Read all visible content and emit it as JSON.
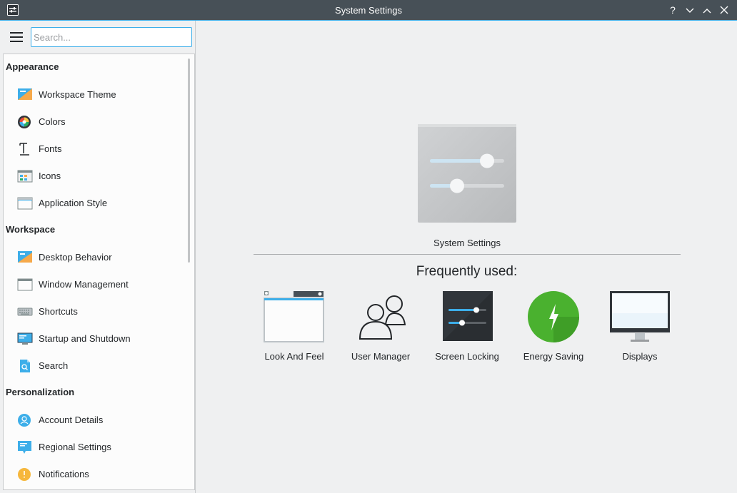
{
  "window": {
    "title": "System Settings",
    "help_glyph": "?",
    "minimize_glyph": "⌄",
    "maximize_glyph": "⌃",
    "close_glyph": "✕"
  },
  "search": {
    "placeholder": "Search..."
  },
  "sidebar": {
    "sections": [
      {
        "title": "Appearance",
        "items": [
          {
            "label": "Workspace Theme",
            "icon": "workspace-theme-icon"
          },
          {
            "label": "Colors",
            "icon": "colors-icon"
          },
          {
            "label": "Fonts",
            "icon": "fonts-icon"
          },
          {
            "label": "Icons",
            "icon": "icons-icon"
          },
          {
            "label": "Application Style",
            "icon": "application-style-icon"
          }
        ]
      },
      {
        "title": "Workspace",
        "items": [
          {
            "label": "Desktop Behavior",
            "icon": "desktop-behavior-icon"
          },
          {
            "label": "Window Management",
            "icon": "window-management-icon"
          },
          {
            "label": "Shortcuts",
            "icon": "keyboard-icon"
          },
          {
            "label": "Startup and Shutdown",
            "icon": "startup-shutdown-icon"
          },
          {
            "label": "Search",
            "icon": "search-icon"
          }
        ]
      },
      {
        "title": "Personalization",
        "items": [
          {
            "label": "Account Details",
            "icon": "account-icon"
          },
          {
            "label": "Regional Settings",
            "icon": "regional-settings-icon"
          },
          {
            "label": "Notifications",
            "icon": "notifications-icon"
          }
        ]
      }
    ]
  },
  "main": {
    "hero_label": "System Settings",
    "frequently_used_title": "Frequently used:",
    "frequent": [
      {
        "label": "Look And Feel",
        "icon": "look-and-feel-icon"
      },
      {
        "label": "User Manager",
        "icon": "users-icon"
      },
      {
        "label": "Screen Locking",
        "icon": "screen-locking-icon"
      },
      {
        "label": "Energy Saving",
        "icon": "energy-saving-icon"
      },
      {
        "label": "Displays",
        "icon": "display-icon"
      }
    ]
  },
  "colors": {
    "accent": "#3daee9",
    "titlebar": "#475057",
    "energy_green": "#4ab12f"
  }
}
